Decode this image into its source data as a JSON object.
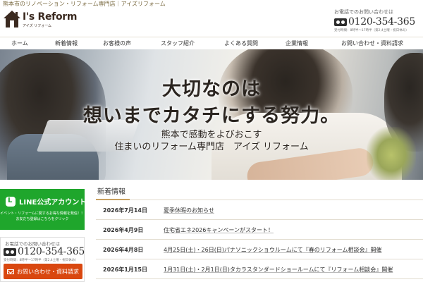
{
  "header": {
    "tagline": "熊本市のリノベーション・リフォーム専門店｜アイズリフォーム",
    "logo_main": "I's Reform",
    "logo_sub": "アイズ リフォーム",
    "contact_label": "お電話でのお問い合わせは",
    "phone": "0120-354-365",
    "hours": "受付時間：8時半〜17時半（第2,4土曜・祝日休み）"
  },
  "nav": {
    "items": [
      "ホーム",
      "新着情報",
      "お客様の声",
      "スタッフ紹介",
      "よくある質問",
      "企業情報",
      "お問い合わせ・資料請求"
    ]
  },
  "hero": {
    "title_line1": "大切なのは",
    "title_line2": "想いまでカタチにする努力。",
    "sub_line1": "熊本で感動をよびおこす",
    "sub_line2": "住まいのリフォーム専門店　アイズ リフォーム"
  },
  "sidebar": {
    "line_title": "LINE公式アカウント",
    "line_desc1": "イベント・リフォームに関するお得な情報を発信！！",
    "line_desc2": "お友だち登録はこちらをクリック",
    "contact_label": "お電話でのお問い合わせは",
    "phone": "0120-354-365",
    "hours": "受付時間：8時半〜17時半（第2,4土曜・祝日休み）",
    "inquiry_label": "お問い合わせ・資料請求"
  },
  "news": {
    "heading": "新着情報",
    "items": [
      {
        "date": "2026年7月14日",
        "title": "夏季休暇のお知らせ"
      },
      {
        "date": "2026年4月9日",
        "title": "住宅省エネ2026キャンペーンがスタート！"
      },
      {
        "date": "2026年4月8日",
        "title": "4月25日(土)・26日(日)パナソニックショウルームにて『春のリフォーム相談会』開催"
      },
      {
        "date": "2026年1月15日",
        "title": "1月31日(土)・2月1日(日)タカラスタンダードショールームにて『リフォーム相談会』開催"
      }
    ]
  },
  "colors": {
    "line_green": "#1fa62c",
    "inquiry_orange": "#d9470f",
    "brand_brown": "#3b2a20",
    "accent_gold": "#c8a060"
  }
}
